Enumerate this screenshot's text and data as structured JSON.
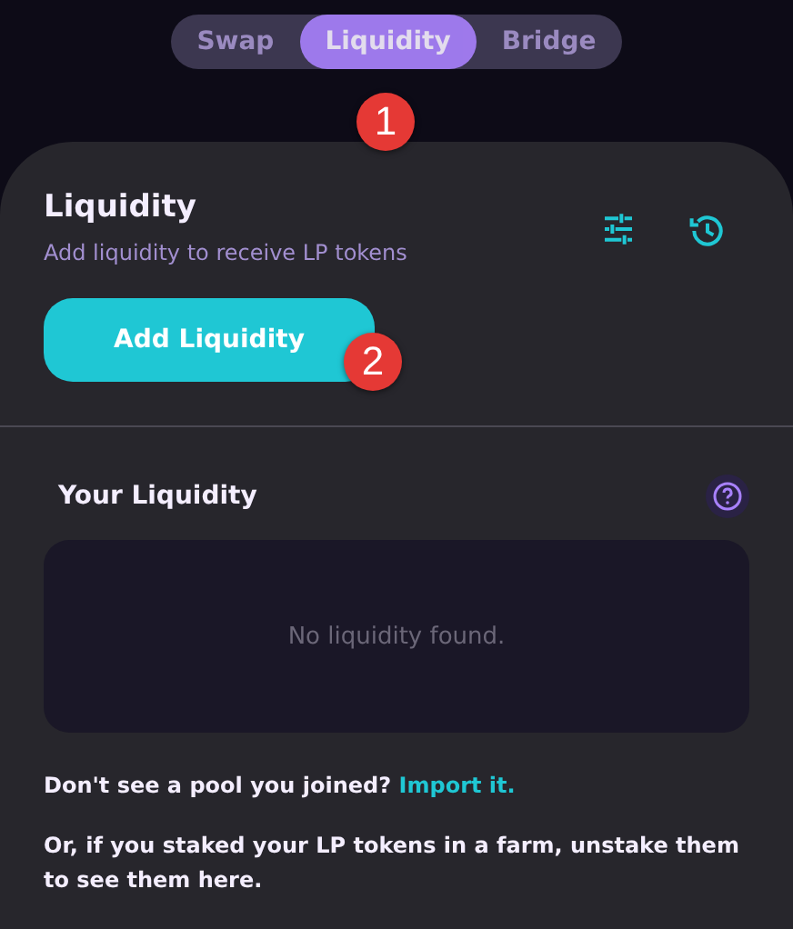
{
  "tabs": [
    {
      "label": "Swap",
      "selected": false
    },
    {
      "label": "Liquidity",
      "selected": true
    },
    {
      "label": "Bridge",
      "selected": false
    }
  ],
  "markers": [
    "1",
    "2"
  ],
  "card": {
    "title": "Liquidity",
    "subtitle": "Add liquidity to receive LP tokens",
    "add_button": "Add Liquidity"
  },
  "your_liquidity": {
    "title": "Your Liquidity",
    "empty_message": "No liquidity found."
  },
  "import_note": {
    "text": "Don't see a pool you joined?",
    "link": "Import it."
  },
  "unstake_note": "Or, if you staked your LP tokens in a farm, unstake them to see them here."
}
